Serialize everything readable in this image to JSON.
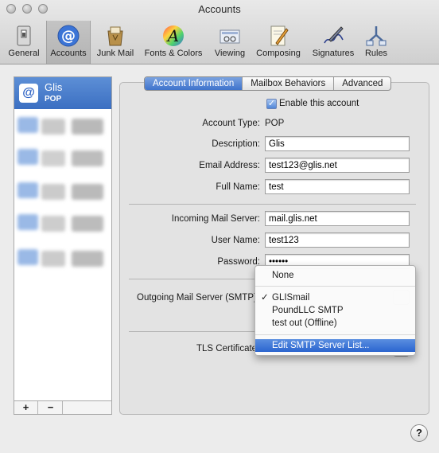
{
  "window": {
    "title": "Accounts"
  },
  "toolbar": {
    "items": [
      {
        "label": "General",
        "icon": "general-switch-icon"
      },
      {
        "label": "Accounts",
        "icon": "at-sign-icon"
      },
      {
        "label": "Junk Mail",
        "icon": "junk-mail-icon"
      },
      {
        "label": "Fonts & Colors",
        "icon": "fonts-colors-icon"
      },
      {
        "label": "Viewing",
        "icon": "viewing-icon"
      },
      {
        "label": "Composing",
        "icon": "composing-icon"
      },
      {
        "label": "Signatures",
        "icon": "signatures-icon"
      },
      {
        "label": "Rules",
        "icon": "rules-icon"
      }
    ],
    "selected": "Accounts"
  },
  "accounts": {
    "selected": {
      "name": "Glis",
      "type": "POP"
    },
    "add_label": "+",
    "remove_label": "−"
  },
  "tabs": [
    "Account Information",
    "Mailbox Behaviors",
    "Advanced"
  ],
  "form": {
    "enable_label": "Enable this account",
    "enabled": true,
    "account_type_label": "Account Type:",
    "account_type": "POP",
    "description_label": "Description:",
    "description": "Glis",
    "email_label": "Email Address:",
    "email": "test123@glis.net",
    "fullname_label": "Full Name:",
    "fullname": "test",
    "incoming_label": "Incoming Mail Server:",
    "incoming": "mail.glis.net",
    "username_label": "User Name:",
    "username": "test123",
    "password_label": "Password:",
    "password": "••••••",
    "outgoing_label": "Outgoing Mail Server (SMTP):",
    "tls_label": "TLS Certificate:"
  },
  "smtp_menu": {
    "none": "None",
    "checkmark": "✓",
    "items": [
      "GLISmail",
      "PoundLLC SMTP",
      "test out (Offline)"
    ],
    "selected": "GLISmail",
    "edit": "Edit SMTP Server List..."
  },
  "help_label": "?",
  "colors": {
    "selection": "#3b6fc2",
    "highlight": "#2b65cf"
  }
}
